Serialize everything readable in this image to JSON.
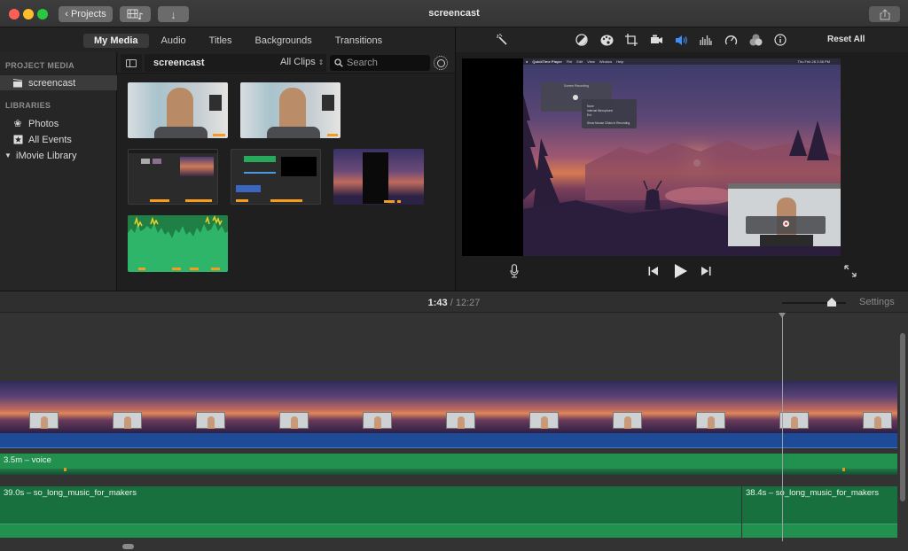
{
  "window": {
    "title": "screencast",
    "buttons": {
      "projects": "Projects"
    }
  },
  "browser_tabs": [
    {
      "label": "My Media",
      "active": true
    },
    {
      "label": "Audio",
      "active": false
    },
    {
      "label": "Titles",
      "active": false
    },
    {
      "label": "Backgrounds",
      "active": false
    },
    {
      "label": "Transitions",
      "active": false
    }
  ],
  "viewer_toolbar": {
    "icons": [
      "magic-wand",
      "color-balance",
      "color-correction",
      "crop",
      "stabilization",
      "volume",
      "noise-reduction-equalizer",
      "speed",
      "video-overlay",
      "clip-info"
    ],
    "reset_all": "Reset All",
    "active_icon": "volume",
    "accent_color": "#3d8ff5"
  },
  "sidebar": {
    "project_media_heading": "PROJECT MEDIA",
    "project_item": "screencast",
    "libraries_heading": "LIBRARIES",
    "library_items": [
      {
        "label": "Photos",
        "icon": "photos"
      },
      {
        "label": "All Events",
        "icon": "star-event"
      },
      {
        "label": "iMovie Library",
        "icon": "disclosure-triangle"
      }
    ]
  },
  "browser": {
    "event_name": "screencast",
    "filter": "All Clips",
    "search_placeholder": "Search",
    "clips": [
      {
        "type": "webcam-video"
      },
      {
        "type": "webcam-video"
      },
      {
        "type": "imovie-screen-recording"
      },
      {
        "type": "imovie-screen-recording"
      },
      {
        "type": "desktop-screen-recording"
      },
      {
        "type": "audio"
      }
    ]
  },
  "viewer": {
    "mac_menubar": [
      "QuickTime Player",
      "File",
      "Edit",
      "View",
      "Window",
      "Help"
    ],
    "mac_status": "Thu Feb 28 2:38 PM",
    "recording_window_title": "Screen Recording",
    "menu_items": [
      "None",
      "Internal Microphone",
      "Ext",
      "Show Mouse Clicks in Recording"
    ]
  },
  "timeline": {
    "current_time": "1:43",
    "separator": "/",
    "total_time": "12:27",
    "settings_label": "Settings",
    "zoom_level": 0.75,
    "voice_clip": "3.5m – voice",
    "music_clips": [
      "39.0s – so_long_music_for_makers",
      "38.4s – so_long_music_for_makers"
    ]
  },
  "colors": {
    "voice_track": "#22904f",
    "music_track": "#17703e",
    "video_audio": "#1e4b98",
    "keyword_bar": "#f59b1e"
  }
}
